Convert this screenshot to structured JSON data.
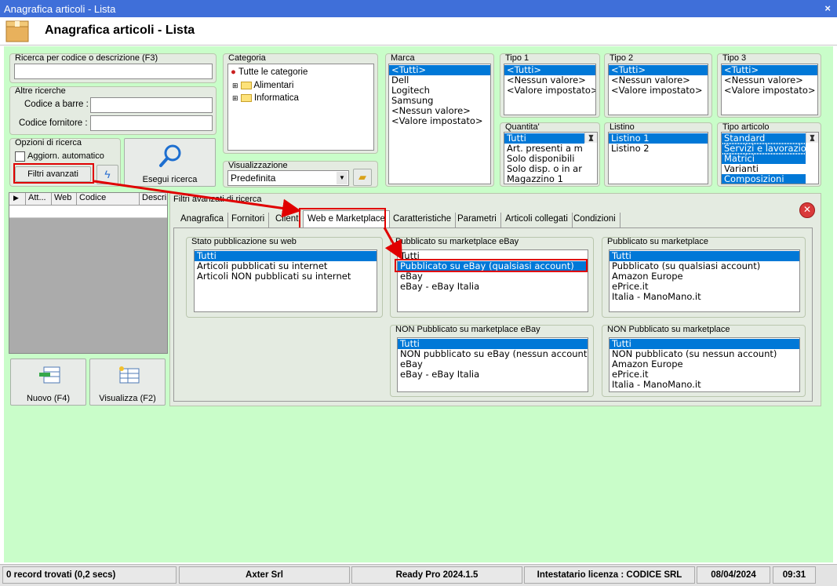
{
  "window": {
    "title": "Anagrafica articoli  - Lista",
    "close": "×"
  },
  "header": {
    "title": "Anagrafica articoli  - Lista"
  },
  "search": {
    "group_label": "Ricerca per codice o descrizione (F3)",
    "value": "",
    "other_label": "Altre ricerche",
    "barcode_label": "Codice a barre :",
    "supplier_code_label": "Codice fornitore :"
  },
  "options": {
    "group_label": "Opzioni di ricerca",
    "auto_update": "Aggiorn. automatico",
    "advanced_filters": "Filtri avanzati",
    "run_search": "Esegui ricerca"
  },
  "category": {
    "label": "Categoria",
    "root": "Tutte le categorie",
    "items": [
      "Alimentari",
      "Informatica"
    ]
  },
  "view": {
    "label": "Visualizzazione",
    "value": "Predefinita"
  },
  "brand": {
    "label": "Marca",
    "items": [
      "<Tutti>",
      "Dell",
      "Logitech",
      "Samsung",
      "<Nessun valore>",
      "<Valore impostato>"
    ],
    "selected": 0
  },
  "tipo1": {
    "label": "Tipo 1",
    "items": [
      "<Tutti>",
      "<Nessun valore>",
      "<Valore impostato>"
    ],
    "selected": 0
  },
  "tipo2": {
    "label": "Tipo 2",
    "items": [
      "<Tutti>",
      "<Nessun valore>",
      "<Valore impostato>"
    ],
    "selected": 0
  },
  "tipo3": {
    "label": "Tipo 3",
    "items": [
      "<Tutti>",
      "<Nessun valore>",
      "<Valore impostato>"
    ],
    "selected": 0
  },
  "quantity": {
    "label": "Quantita'",
    "items": [
      "Tutti",
      "Art. presenti a m",
      "Solo disponibili",
      "Solo disp. o in ar",
      "Magazzino 1"
    ],
    "selected": 0
  },
  "pricelist": {
    "label": "Listino",
    "items": [
      "Listino 1",
      "Listino 2"
    ],
    "selected": 0
  },
  "article_type": {
    "label": "Tipo articolo",
    "items": [
      "Standard",
      "Servizi e lavorazio",
      "Matrici",
      "Varianti",
      "Composizioni"
    ]
  },
  "grid": {
    "columns": [
      "Att...",
      "Web",
      "Codice",
      "Descri"
    ]
  },
  "actions": {
    "new": "Nuovo (F4)",
    "view": "Visualizza (F2)"
  },
  "advanced": {
    "title": "Filtri avanzati di ricerca",
    "tabs": [
      "Anagrafica",
      "Fornitori",
      "Clienti",
      "Web e Marketplace",
      "Caratteristiche",
      "Parametri",
      "Articoli collegati",
      "Condizioni"
    ],
    "active_tab": 3,
    "web_status": {
      "label": "Stato pubblicazione su web",
      "items": [
        "Tutti",
        "Articoli pubblicati su internet",
        "Articoli NON pubblicati su internet"
      ]
    },
    "ebay_pub": {
      "label": "Pubblicato su marketplace eBay",
      "items": [
        "Tutti",
        "Pubblicato su eBay (qualsiasi account)",
        "eBay",
        "eBay - eBay Italia"
      ]
    },
    "mp_pub": {
      "label": "Pubblicato su marketplace",
      "items": [
        "Tutti",
        "Pubblicato (su qualsiasi account)",
        "Amazon Europe",
        "ePrice.it",
        "Italia - ManoMano.it"
      ]
    },
    "ebay_notpub": {
      "label": "NON Pubblicato su marketplace eBay",
      "items": [
        "Tutti",
        "NON pubblicato su eBay (nessun account)",
        "eBay",
        "eBay - eBay Italia"
      ]
    },
    "mp_notpub": {
      "label": "NON Pubblicato su marketplace",
      "items": [
        "Tutti",
        "NON pubblicato (su nessun account)",
        "Amazon Europe",
        "ePrice.it",
        "Italia - ManoMano.it"
      ]
    }
  },
  "status": {
    "records": "0 record trovati (0,2 secs)",
    "company": "Axter Srl",
    "version": "Ready Pro 2024.1.5",
    "license": "Intestatario licenza : CODICE SRL",
    "date": "08/04/2024",
    "time": "09:31"
  },
  "colors": {
    "titlebar": "#3f6fd9",
    "background": "#c9fdc9",
    "selection": "#0078d7",
    "highlight": "#e00000"
  }
}
